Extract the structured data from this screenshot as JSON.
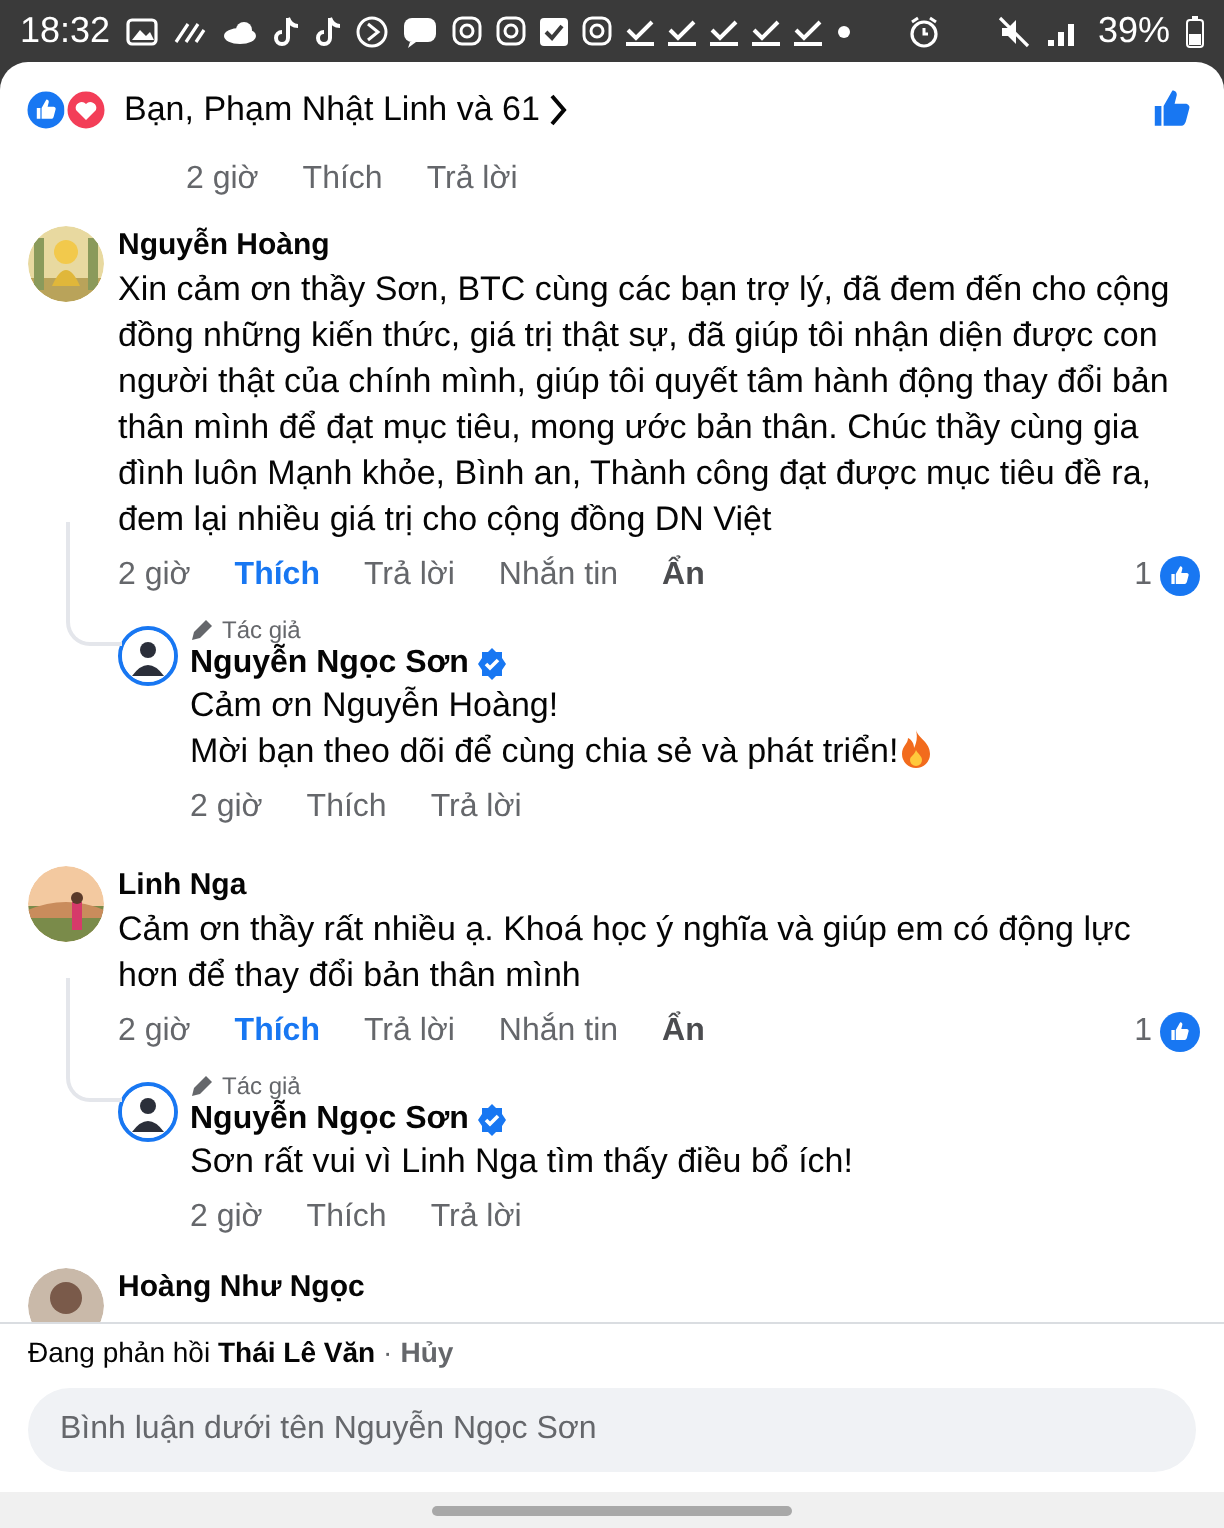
{
  "status_bar": {
    "time": "18:32",
    "battery": "39%"
  },
  "header": {
    "summary": "Bạn, Phạm Nhật Linh và 61",
    "liked": true
  },
  "previous_actions": {
    "time": "2 giờ",
    "actions": [
      {
        "label": "Thích",
        "emphasized": false,
        "selected": false
      },
      {
        "label": "Trả lời",
        "emphasized": false,
        "selected": false
      }
    ]
  },
  "comments": [
    {
      "author": "Nguyễn Hoàng",
      "text": "Xin cảm ơn thầy Sơn, BTC cùng các bạn trợ lý, đã đem đến cho cộng đồng những kiến thức, giá trị thật sự, đã giúp tôi nhận diện được con người thật của chính mình, giúp tôi quyết tâm hành động thay đổi bản thân mình để đạt mục tiêu, mong ước bản thân. Chúc thầy cùng gia đình luôn Mạnh khỏe, Bình an, Thành công đạt được mục tiêu đề ra, đem lại nhiều giá trị cho cộng đồng DN Việt",
      "time": "2 giờ",
      "actions": [
        {
          "label": "Thích",
          "emphasized": false,
          "selected": true
        },
        {
          "label": "Trả lời",
          "emphasized": false,
          "selected": false
        },
        {
          "label": "Nhắn tin",
          "emphasized": false,
          "selected": false
        },
        {
          "label": "Ẩn",
          "emphasized": true,
          "selected": false
        }
      ],
      "reaction_count": "1",
      "replies": [
        {
          "badge": "Tác giả",
          "author": "Nguyễn Ngọc Sơn",
          "verified": true,
          "lines": [
            "Cảm ơn Nguyễn Hoàng!",
            "Mời bạn theo dõi để cùng chia sẻ và phát triển!"
          ],
          "has_emoji": true,
          "time": "2 giờ",
          "actions": [
            {
              "label": "Thích",
              "emphasized": false,
              "selected": false
            },
            {
              "label": "Trả lời",
              "emphasized": false,
              "selected": false
            }
          ]
        }
      ]
    },
    {
      "author": "Linh Nga",
      "text": "Cảm ơn thầy rất nhiều ạ. Khoá học ý nghĩa và giúp em có động lực hơn để thay đổi bản thân mình",
      "time": "2 giờ",
      "actions": [
        {
          "label": "Thích",
          "emphasized": false,
          "selected": true
        },
        {
          "label": "Trả lời",
          "emphasized": false,
          "selected": false
        },
        {
          "label": "Nhắn tin",
          "emphasized": false,
          "selected": false
        },
        {
          "label": "Ẩn",
          "emphasized": true,
          "selected": false
        }
      ],
      "reaction_count": "1",
      "replies": [
        {
          "badge": "Tác giả",
          "author": "Nguyễn Ngọc Sơn",
          "verified": true,
          "lines": [
            "Sơn rất vui vì Linh Nga tìm thấy điều bổ ích!"
          ],
          "has_emoji": false,
          "time": "2 giờ",
          "actions": [
            {
              "label": "Thích",
              "emphasized": false,
              "selected": false
            },
            {
              "label": "Trả lời",
              "emphasized": false,
              "selected": false
            }
          ]
        }
      ]
    },
    {
      "author": "Hoàng Như Ngọc"
    }
  ],
  "composer": {
    "replying_to": "Đang phản hồi **Thái Lê Văn**",
    "separator": "·",
    "cancel": "Hủy",
    "placeholder": "Bình luận dưới tên Nguyễn Ngọc Sơn"
  }
}
